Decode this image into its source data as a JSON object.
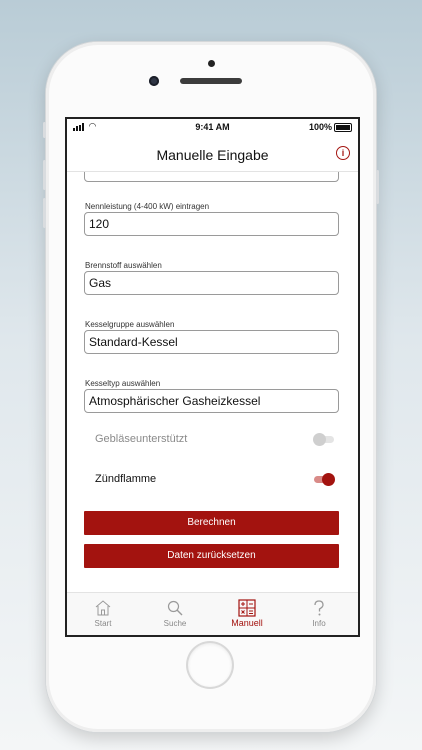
{
  "status_bar": {
    "time": "9:41 AM",
    "battery": "100%"
  },
  "header": {
    "title": "Manuelle Eingabe"
  },
  "form": {
    "nennleistung": {
      "label": "Nennleistung (4-400 kW) eintragen",
      "value": "120"
    },
    "brennstoff": {
      "label": "Brennstoff auswählen",
      "value": "Gas"
    },
    "kesselgruppe": {
      "label": "Kesselgruppe auswählen",
      "value": "Standard-Kessel"
    },
    "kesseltyp": {
      "label": "Kesseltyp auswählen",
      "value": "Atmosphärischer Gasheizkessel"
    },
    "geblaese": {
      "label": "Gebläseunterstützt",
      "enabled": false,
      "on": false
    },
    "zuendflamme": {
      "label": "Zündflamme",
      "enabled": true,
      "on": true
    }
  },
  "buttons": {
    "calculate": "Berechnen",
    "reset": "Daten zurücksetzen"
  },
  "tabs": [
    {
      "label": "Start",
      "icon": "home-icon",
      "active": false
    },
    {
      "label": "Suche",
      "icon": "search-icon",
      "active": false
    },
    {
      "label": "Manuell",
      "icon": "calculator-icon",
      "active": true
    },
    {
      "label": "Info",
      "icon": "question-icon",
      "active": false
    }
  ],
  "colors": {
    "accent": "#a3130f",
    "disabled_text": "#8a8a8a",
    "toggle_off": "#cfcfcf"
  }
}
